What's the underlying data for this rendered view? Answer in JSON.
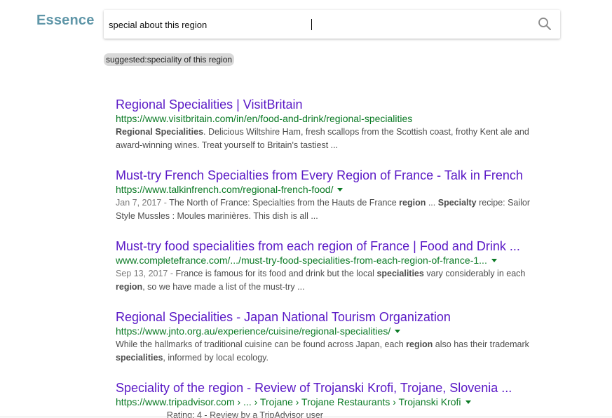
{
  "brand": {
    "name": "Essence"
  },
  "search": {
    "query": "special about this region",
    "suggestion": "suggested:speciality of this region"
  },
  "colors": {
    "title": "#5a19c6",
    "url": "#0b7a25",
    "snippet": "#4d4d4d",
    "logo": "#5f96a8"
  },
  "results": [
    {
      "title": "Regional Specialities | VisitBritain",
      "url": "https://www.visitbritain.com/in/en/food-and-drink/regional-specialities",
      "has_dropdown": false,
      "snippet_html": "<b>Regional Specialities</b>. Delicious Wiltshire Ham, fresh scallops from the Scottish coast, frothy Kent ale and award-winning wines. Treat yourself to Britain's tastiest ..."
    },
    {
      "title": "Must-try French Specialties from Every Region of France - Talk in French",
      "url": "https://www.talkinfrench.com/regional-french-food/",
      "has_dropdown": true,
      "snippet_html": "<span class=\"date\">Jan 7, 2017 - </span>The North of France: Specialties from the Hauts de France <b>region</b> ... <b>Specialty</b> recipe: Sailor Style Mussles : Moules marinières. This dish is all ..."
    },
    {
      "title": "Must-try food specialities from each region of France | Food and Drink ...",
      "url": "www.completefrance.com/.../must-try-food-specialities-from-each-region-of-france-1...",
      "has_dropdown": true,
      "snippet_html": "<span class=\"date\">Sep 13, 2017 - </span>France is famous for its food and drink but the local <b>specialities</b> vary considerably in each <b>region</b>, so we have made a list of the must-try ..."
    },
    {
      "title": "Regional Specialities - Japan National Tourism Organization",
      "url": "https://www.jnto.org.au/experience/cuisine/regional-specialities/",
      "has_dropdown": true,
      "snippet_html": "While the hallmarks of traditional cuisine can be found across Japan, each <b>region</b> also has their trademark <b>specialities</b>, informed by local ecology."
    },
    {
      "title": "Speciality of the region - Review of Trojanski Krofi, Trojane, Slovenia ...",
      "url": "https://www.tripadvisor.com › ... › Trojane › Trojane Restaurants › Trojanski Krofi",
      "has_dropdown": true,
      "snippet_html": "&nbsp;&nbsp;&nbsp;&nbsp;&nbsp;&nbsp;&nbsp;&nbsp;&nbsp;&nbsp;&nbsp;&nbsp;&nbsp;&nbsp;&nbsp;&nbsp;&nbsp;&nbsp;&nbsp;&nbsp;&nbsp;Rating: 4 - Review by a TripAdvisor user"
    }
  ]
}
